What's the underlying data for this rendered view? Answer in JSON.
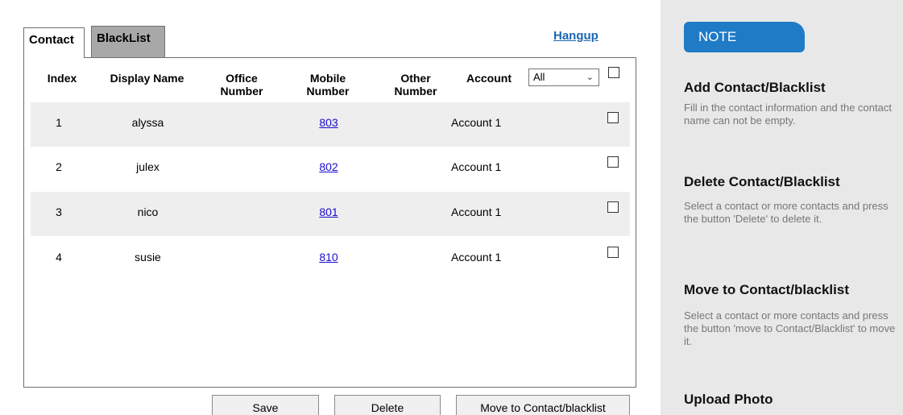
{
  "tabs": {
    "contact": "Contact",
    "blacklist": "BlackList"
  },
  "hangup": "Hangup",
  "table": {
    "headers": {
      "index": "Index",
      "display_name": "Display Name",
      "office_number": "Office Number",
      "mobile_number": "Mobile Number",
      "other_number": "Other Number",
      "account": "Account"
    },
    "account_filter": "All",
    "rows": [
      {
        "index": "1",
        "name": "alyssa",
        "office": "",
        "mobile": "803",
        "other": "",
        "account": "Account 1"
      },
      {
        "index": "2",
        "name": "julex",
        "office": "",
        "mobile": "802",
        "other": "",
        "account": "Account 1"
      },
      {
        "index": "3",
        "name": "nico",
        "office": "",
        "mobile": "801",
        "other": "",
        "account": "Account 1"
      },
      {
        "index": "4",
        "name": "susie",
        "office": "",
        "mobile": "810",
        "other": "",
        "account": "Account 1"
      }
    ]
  },
  "buttons": {
    "save": "Save",
    "delete": "Delete",
    "move": "Move to Contact/blacklist"
  },
  "note": {
    "title": "NOTE",
    "sections": [
      {
        "heading": "Add Contact/Blacklist",
        "text": "Fill in the contact information and the contact name can not be empty."
      },
      {
        "heading": "Delete Contact/Blacklist",
        "text": "Select a contact or more contacts and press the button 'Delete' to delete it."
      },
      {
        "heading": "Move to Contact/blacklist",
        "text": "Select a contact or more contacts and press the button 'move to Contact/Blacklist' to move it."
      },
      {
        "heading": "Upload Photo",
        "text": ""
      }
    ]
  },
  "colors": {
    "note_accent": "#1f7bc6",
    "link": "#1a0dcc",
    "hangup_link": "#1a66b3",
    "row_shade": "#eeeeee",
    "inactive_tab": "#a8a8a8"
  }
}
